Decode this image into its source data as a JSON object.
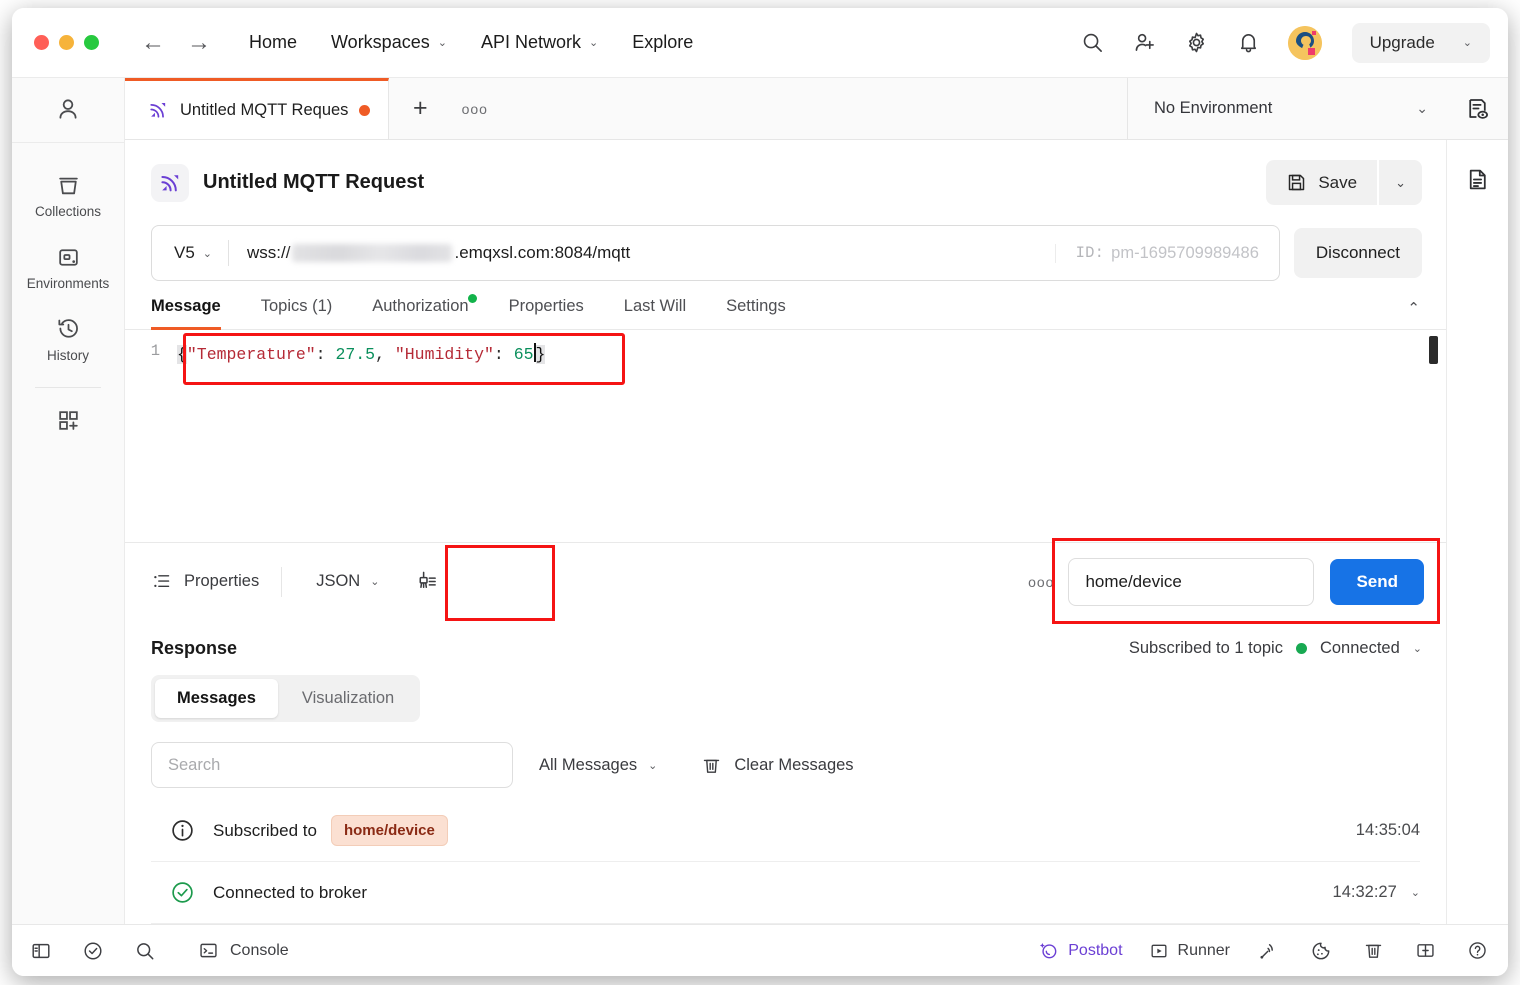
{
  "window": {
    "traffic_lights": [
      "close",
      "minimize",
      "maximize"
    ]
  },
  "header": {
    "back_arrow": "←",
    "forward_arrow": "→",
    "links": [
      {
        "label": "Home",
        "has_caret": false
      },
      {
        "label": "Workspaces",
        "has_caret": true
      },
      {
        "label": "API Network",
        "has_caret": true
      },
      {
        "label": "Explore",
        "has_caret": false
      }
    ],
    "icons": [
      "search-icon",
      "invite-user-icon",
      "settings-gear-icon",
      "notifications-bell-icon"
    ],
    "upgrade_label": "Upgrade",
    "caret": "⌄"
  },
  "sidebar": {
    "user_icon": "user-avatar-icon",
    "items": [
      {
        "label": "Collections",
        "icon": "collections-icon"
      },
      {
        "label": "Environments",
        "icon": "environments-icon"
      },
      {
        "label": "History",
        "icon": "history-icon"
      }
    ],
    "new_item_icon": "new-grid-icon"
  },
  "tabstrip": {
    "tab_name": "Untitled MQTT Request",
    "unsaved": true,
    "new_tab": "+",
    "more": "ooo",
    "environment": "No Environment",
    "env_caret": "⌄",
    "env_quick_look_icon": "environment-quick-look-icon"
  },
  "request": {
    "title": "Untitled MQTT Request",
    "icon": "mqtt-broadcast-icon",
    "save_label": "Save",
    "save_caret": "⌄",
    "protocol_version": "V5",
    "version_caret": "⌄",
    "url_scheme": "wss://",
    "url_host_redacted": true,
    "url_rest": ".emqxsl.com:8084/mqtt",
    "id_label": "ID:",
    "id_value": "pm-1695709989486",
    "disconnect_label": "Disconnect",
    "tabs": [
      {
        "label": "Message",
        "active": true,
        "dot": false
      },
      {
        "label": "Topics (1)",
        "active": false,
        "dot": false
      },
      {
        "label": "Authorization",
        "active": false,
        "dot": true
      },
      {
        "label": "Properties",
        "active": false,
        "dot": false
      },
      {
        "label": "Last Will",
        "active": false,
        "dot": false
      },
      {
        "label": "Settings",
        "active": false,
        "dot": false
      }
    ],
    "collapse_caret": "⌃"
  },
  "editor": {
    "line_number": "1",
    "tokens": {
      "open_brace": "{",
      "key_temperature": "\"Temperature\"",
      "colon1": ": ",
      "value_temperature": "27.5",
      "comma": ", ",
      "key_humidity": "\"Humidity\"",
      "colon2": ": ",
      "value_humidity": "65",
      "close_brace": "}"
    },
    "full_text": "{\"Temperature\": 27.5, \"Humidity\": 65}",
    "highlight_color": "#f51414"
  },
  "message_toolbar": {
    "properties_label": "Properties",
    "format_label": "JSON",
    "format_caret": "⌄",
    "beautify_icon": "beautify-icon",
    "more": "ooo",
    "topic_value": "home/device",
    "send_label": "Send",
    "send_color": "#1773e6"
  },
  "response": {
    "title": "Response",
    "subscribed_text": "Subscribed to 1 topic",
    "connection_status": "Connected",
    "status_color": "#18a952",
    "collapse_caret": "⌄",
    "segments": [
      {
        "label": "Messages",
        "active": true
      },
      {
        "label": "Visualization",
        "active": false
      }
    ],
    "search_placeholder": "Search",
    "filter_label": "All Messages",
    "filter_caret": "⌄",
    "clear_label": "Clear Messages",
    "messages": [
      {
        "icon": "info-circle-icon",
        "text": "Subscribed to",
        "badge": "home/device",
        "time": "14:35:04",
        "expandable": false
      },
      {
        "icon": "check-circle-icon",
        "text": "Connected to broker",
        "badge": null,
        "time": "14:32:27",
        "expandable": true
      }
    ]
  },
  "statusbar": {
    "left_icons": [
      "sidebar-toggle-icon",
      "check-circle-icon",
      "search-icon"
    ],
    "console_label": "Console",
    "postbot_label": "Postbot",
    "runner_label": "Runner",
    "right_icons": [
      "mqtt-signal-icon",
      "cookie-icon",
      "trash-icon",
      "layout-icon",
      "help-icon"
    ]
  }
}
